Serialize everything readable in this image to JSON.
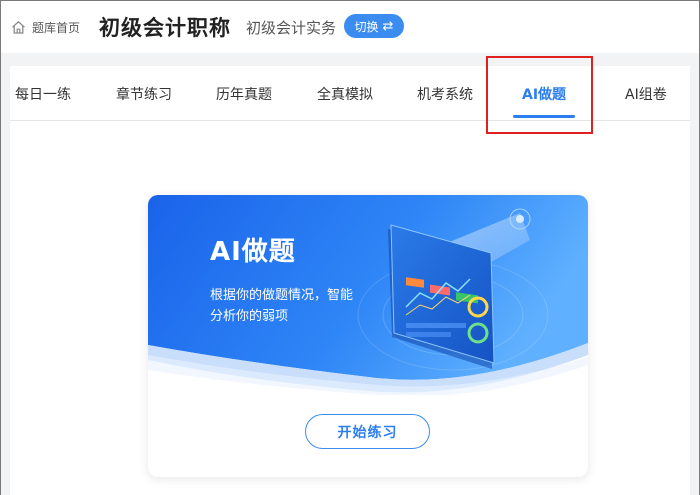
{
  "header": {
    "home_label": "题库首页",
    "title": "初级会计职称",
    "subject": "初级会计实务",
    "switch_label": "切换",
    "switch_icon": "⇄"
  },
  "tabs": [
    {
      "label": "每日一练",
      "active": false
    },
    {
      "label": "章节练习",
      "active": false
    },
    {
      "label": "历年真题",
      "active": false
    },
    {
      "label": "全真模拟",
      "active": false
    },
    {
      "label": "机考系统",
      "active": false
    },
    {
      "label": "AI做题",
      "active": true
    },
    {
      "label": "AI组卷",
      "active": false
    }
  ],
  "card": {
    "title": "AI做题",
    "description": "根据你的做题情况，智能分析你的弱项",
    "start_label": "开始练习"
  },
  "colors": {
    "accent": "#2c7ff0",
    "banner_start": "#1f6ff0",
    "banner_end": "#4fa6ff",
    "highlight": "#e12020"
  }
}
